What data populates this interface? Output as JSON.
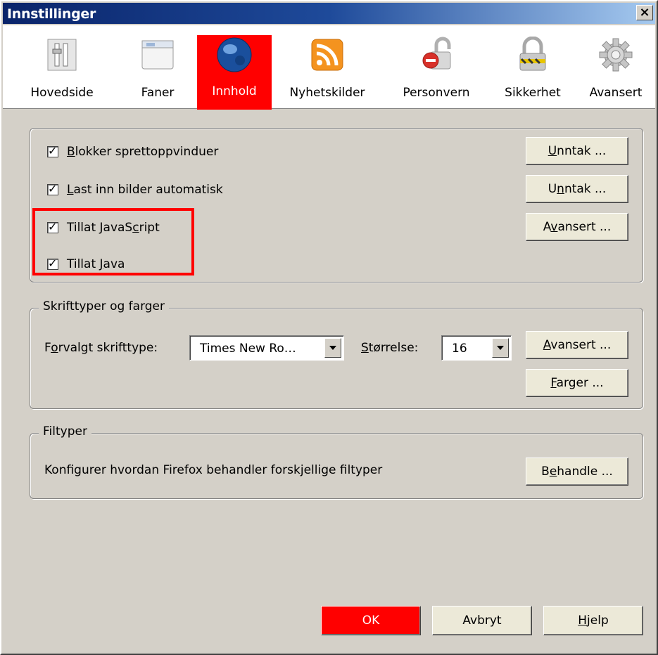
{
  "window": {
    "title": "Innstillinger",
    "close_glyph": "×"
  },
  "toolbar": {
    "items": [
      {
        "label": "Hovedside",
        "icon": "main-switch-icon",
        "selected": false
      },
      {
        "label": "Faner",
        "icon": "tabs-window-icon",
        "selected": false
      },
      {
        "label": "Innhold",
        "icon": "globe-icon",
        "selected": true
      },
      {
        "label": "Nyhetskilder",
        "icon": "rss-feed-icon",
        "selected": false
      },
      {
        "label": "Personvern",
        "icon": "privacy-lock-icon",
        "selected": false
      },
      {
        "label": "Sikkerhet",
        "icon": "padlock-icon",
        "selected": false
      },
      {
        "label": "Avansert",
        "icon": "gear-icon",
        "selected": false
      }
    ]
  },
  "content": {
    "checkboxes": [
      {
        "pre": "",
        "u": "B",
        "post": "lokker sprettoppvinduer",
        "checked": true
      },
      {
        "pre": "",
        "u": "L",
        "post": "ast inn bilder automatisk",
        "checked": true
      },
      {
        "pre": "Tillat JavaS",
        "u": "c",
        "post": "ript",
        "checked": true
      },
      {
        "pre": "Tillat ",
        "u": "J",
        "post": "ava",
        "checked": true
      }
    ],
    "buttons": [
      {
        "pre": "",
        "u": "U",
        "post": "nntak ..."
      },
      {
        "pre": "U",
        "u": "n",
        "post": "ntak ..."
      },
      {
        "pre": "A",
        "u": "v",
        "post": "ansert ..."
      }
    ],
    "check_glyph": "✓"
  },
  "fonts": {
    "legend": "Skrifttyper og farger",
    "default_font_label": {
      "pre": "F",
      "u": "o",
      "post": "rvalgt skrifttype:"
    },
    "default_font_value": "Times New Ro…",
    "size_label": {
      "pre": "",
      "u": "S",
      "post": "tørrelse:"
    },
    "size_value": "16",
    "advanced_button": {
      "pre": "",
      "u": "A",
      "post": "vansert ..."
    },
    "colors_button": {
      "pre": "",
      "u": "F",
      "post": "arger ..."
    }
  },
  "filetypes": {
    "legend": "Filtyper",
    "description": "Konfigurer hvordan Firefox behandler forskjellige filtyper",
    "manage_button": {
      "pre": "B",
      "u": "e",
      "post": "handle ..."
    }
  },
  "dialog_buttons": {
    "ok": "OK",
    "cancel": "Avbryt",
    "help": {
      "pre": "",
      "u": "H",
      "post": "jelp"
    }
  },
  "colors": {
    "highlight": "#ff0000",
    "dialog_bg": "#d4d0c8",
    "title_bar": "#0a246a"
  }
}
